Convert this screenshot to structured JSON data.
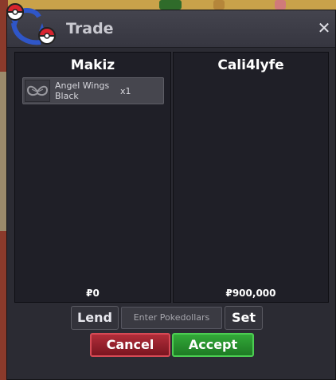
{
  "window": {
    "title": "Trade",
    "close_glyph": "✕"
  },
  "left_panel": {
    "player_name": "Makiz",
    "items": [
      {
        "name": "Angel Wings Black",
        "quantity": "x1",
        "icon": "angel-wings-icon"
      }
    ],
    "money": "₽0"
  },
  "right_panel": {
    "player_name": "Cali4lyfe",
    "items": [],
    "money": "₽900,000"
  },
  "controls": {
    "lend_label": "Lend",
    "money_placeholder": "Enter Pokedollars",
    "set_label": "Set",
    "cancel_label": "Cancel",
    "accept_label": "Accept"
  },
  "colors": {
    "cancel": "#b12d39",
    "accept": "#32a838",
    "window_bg": "#2b2b33"
  }
}
